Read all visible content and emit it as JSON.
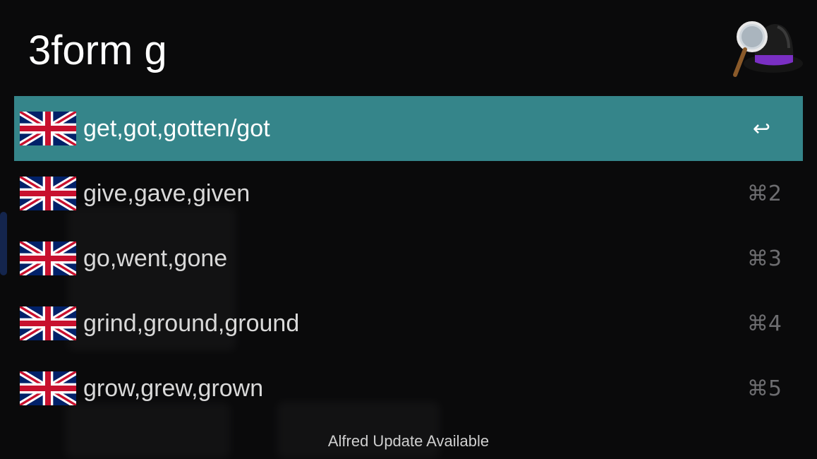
{
  "search": {
    "query": "3form g"
  },
  "logo": {
    "icon": "alfred-hat-icon"
  },
  "results": [
    {
      "title": "get,got,gotten/got",
      "shortcut": "↩",
      "icon": "uk-flag-icon",
      "selected": true
    },
    {
      "title": "give,gave,given",
      "shortcut": "⌘2",
      "icon": "uk-flag-icon",
      "selected": false
    },
    {
      "title": "go,went,gone",
      "shortcut": "⌘3",
      "icon": "uk-flag-icon",
      "selected": false
    },
    {
      "title": "grind,ground,ground",
      "shortcut": "⌘4",
      "icon": "uk-flag-icon",
      "selected": false
    },
    {
      "title": "grow,grew,grown",
      "shortcut": "⌘5",
      "icon": "uk-flag-icon",
      "selected": false
    }
  ],
  "footer": {
    "text": "Alfred Update Available"
  },
  "colors": {
    "selected_row": "#35858a",
    "background": "#0a0a0b",
    "hat_band": "#7a2fc4"
  }
}
